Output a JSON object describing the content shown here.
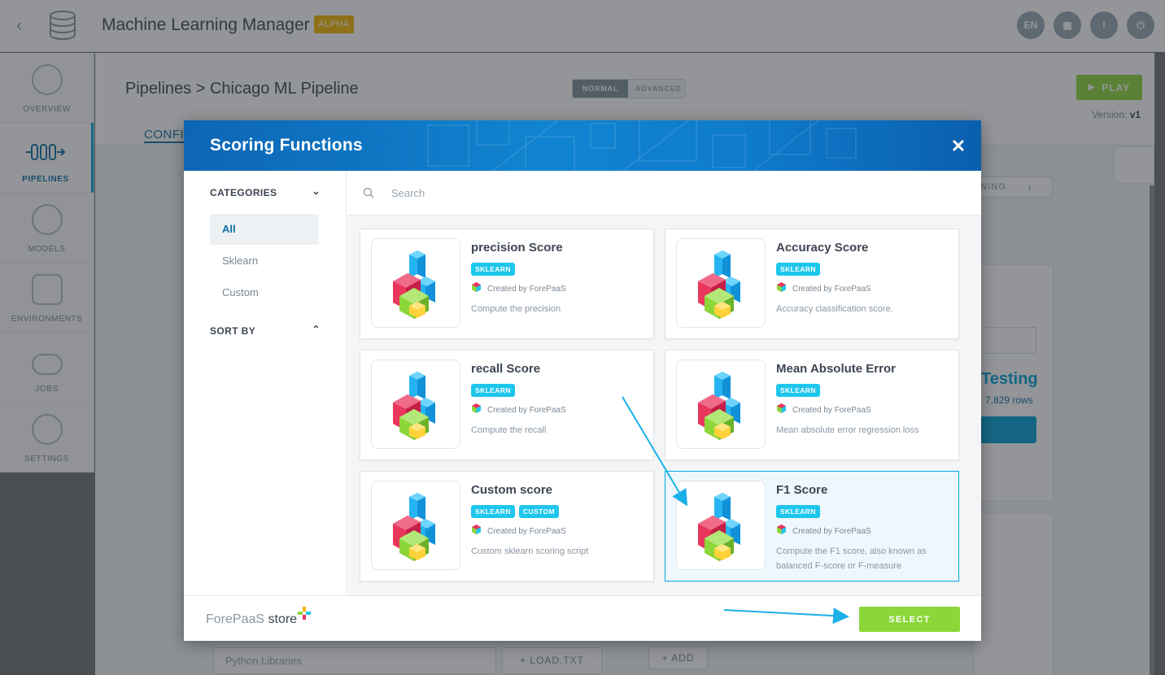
{
  "app": {
    "title": "Machine Learning Manager",
    "badge": "ALPHA",
    "lang": "EN"
  },
  "sidebar": {
    "items": [
      {
        "label": "OVERVIEW",
        "icon": "overview-icon"
      },
      {
        "label": "PIPELINES",
        "icon": "pipelines-icon",
        "active": true
      },
      {
        "label": "MODELS",
        "icon": "models-icon"
      },
      {
        "label": "ENVIRONMENTS",
        "icon": "environments-icon"
      },
      {
        "label": "JOBS",
        "icon": "jobs-icon"
      },
      {
        "label": "SETTINGS",
        "icon": "settings-icon"
      }
    ]
  },
  "page": {
    "breadcrumb_root": "Pipelines",
    "breadcrumb_sep": ">",
    "breadcrumb_current": "Chicago ML Pipeline",
    "mode_normal": "NORMAL",
    "mode_advanced": "ADVANCED",
    "play_label": "PLAY",
    "version_label": "Version:",
    "version_value": "v1",
    "config_tab": "CONFI",
    "ning_label": "NING",
    "testing_title": "Testing",
    "testing_rows": "7,829 rows",
    "libs_placeholder": "Python Libraries",
    "load_label": "LOAD.TXT",
    "add_label": "ADD"
  },
  "modal": {
    "title": "Scoring Functions",
    "categories_label": "CATEGORIES",
    "categories": [
      "All",
      "Sklearn",
      "Custom"
    ],
    "active_category": "All",
    "sort_label": "SORT BY",
    "search_placeholder": "Search",
    "cards": [
      {
        "name": "precision Score",
        "tags": [
          "SKLEARN"
        ],
        "creator": "Created by ForePaaS",
        "desc": "Compute the precision"
      },
      {
        "name": "Accuracy Score",
        "tags": [
          "SKLEARN"
        ],
        "creator": "Created by ForePaaS",
        "desc": "Accuracy classification score."
      },
      {
        "name": "recall Score",
        "tags": [
          "SKLEARN"
        ],
        "creator": "Created by ForePaaS",
        "desc": "Compute the recall"
      },
      {
        "name": "Mean Absolute Error",
        "tags": [
          "SKLEARN"
        ],
        "creator": "Created by ForePaaS",
        "desc": "Mean absolute error regression loss"
      },
      {
        "name": "Custom score",
        "tags": [
          "SKLEARN",
          "CUSTOM"
        ],
        "creator": "Created by ForePaaS",
        "desc": "Custom sklearn scoring script"
      },
      {
        "name": "F1 Score",
        "tags": [
          "SKLEARN"
        ],
        "creator": "Created by ForePaaS",
        "desc": "Compute the F1 score, also known as balanced F-score or F-measure",
        "selected": true
      }
    ],
    "brand_name": "ForePaaS",
    "brand_suffix": "store",
    "select_label": "SELECT"
  },
  "colors": {
    "accent": "#00a0d6",
    "play_green": "#8dd63a",
    "tag_cyan": "#1ec6ec",
    "header_blue": "#0f7ccc",
    "alpha_yellow": "#f5b400"
  }
}
